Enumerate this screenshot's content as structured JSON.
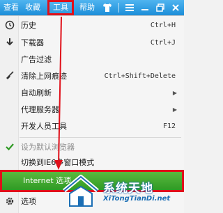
{
  "topbar": {
    "menus": [
      {
        "label": "查看"
      },
      {
        "label": "收藏"
      },
      {
        "label": "工具"
      },
      {
        "label": "帮助"
      }
    ]
  },
  "menu": {
    "items": [
      {
        "label": "历史",
        "shortcut": "Ctrl+H",
        "icon": "clock-icon"
      },
      {
        "label": "下载器",
        "shortcut": "Ctrl+J",
        "icon": "download-icon"
      },
      {
        "label": "广告过滤",
        "shortcut": "",
        "icon": ""
      },
      {
        "label": "清除上网痕迹",
        "shortcut": "Ctrl+Shift+Delete",
        "icon": "broom-icon"
      },
      {
        "label": "自动刷新",
        "submenu": true
      },
      {
        "label": "代理服务器",
        "submenu": true
      },
      {
        "label": "开发人员工具",
        "shortcut": "F12"
      },
      {
        "label": "设为默认浏览器",
        "disabled": true,
        "icon": "check-icon"
      },
      {
        "label": "切换到IE6多窗口模式"
      },
      {
        "label": "Internet 选项",
        "highlighted": true
      },
      {
        "label": "选项",
        "icon": "gear-icon"
      }
    ]
  },
  "watermark": {
    "title": "系统天地",
    "subtitle": "XiTongTianDi.net"
  },
  "colors": {
    "topbar": "#1c8ed8",
    "highlight": "#3aa52c",
    "annotation": "#e0101a"
  }
}
